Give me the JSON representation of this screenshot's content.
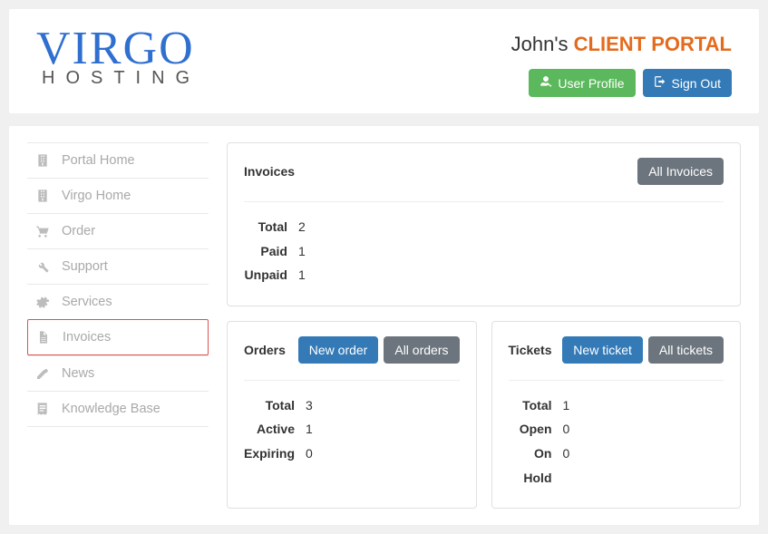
{
  "logo": {
    "main": "VIRGO",
    "sub": "HOSTING"
  },
  "header": {
    "owner": "John's",
    "brand": "CLIENT PORTAL",
    "user_profile_label": "User Profile",
    "sign_out_label": "Sign Out"
  },
  "sidebar": {
    "items": [
      {
        "label": "Portal Home",
        "icon": "building-icon"
      },
      {
        "label": "Virgo Home",
        "icon": "building-icon"
      },
      {
        "label": "Order",
        "icon": "cart-icon"
      },
      {
        "label": "Support",
        "icon": "wrench-icon"
      },
      {
        "label": "Services",
        "icon": "cogs-icon"
      },
      {
        "label": "Invoices",
        "icon": "file-icon",
        "active": true
      },
      {
        "label": "News",
        "icon": "edit-icon"
      },
      {
        "label": "Knowledge Base",
        "icon": "book-icon"
      }
    ]
  },
  "invoices": {
    "title": "Invoices",
    "all_btn": "All Invoices",
    "stats": {
      "total_label": "Total",
      "total_value": "2",
      "paid_label": "Paid",
      "paid_value": "1",
      "unpaid_label": "Unpaid",
      "unpaid_value": "1"
    }
  },
  "orders": {
    "title": "Orders",
    "new_btn": "New order",
    "all_btn": "All orders",
    "stats": {
      "total_label": "Total",
      "total_value": "3",
      "active_label": "Active",
      "active_value": "1",
      "expiring_label": "Expiring",
      "expiring_value": "0"
    }
  },
  "tickets": {
    "title": "Tickets",
    "new_btn": "New ticket",
    "all_btn": "All tickets",
    "stats": {
      "total_label": "Total",
      "total_value": "1",
      "open_label": "Open",
      "open_value": "0",
      "onhold_label": "On Hold",
      "onhold_value": "0"
    }
  }
}
